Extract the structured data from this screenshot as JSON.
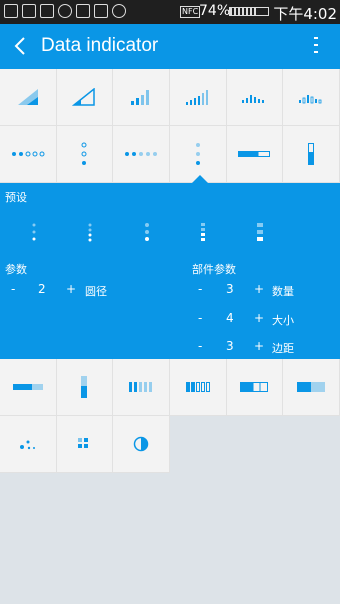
{
  "status": {
    "battery": "74%",
    "nfc": "NFC",
    "time": "下午4:02"
  },
  "appbar": {
    "title": "Data indicator"
  },
  "grid_top": {
    "row1": [
      "signal-triangle-filled-icon",
      "signal-triangle-outline-icon",
      "signal-bars-tall-icon",
      "signal-bars-many-icon",
      "equalizer-bars-icon",
      "dotted-bars-icon"
    ],
    "row2": [
      "dots-horizontal-icon",
      "dots-vertical-icon",
      "dots-horizontal-fade-icon",
      "dots-vertical-fade-icon",
      "horizontal-progress-icon",
      "vertical-progress-icon"
    ]
  },
  "panel": {
    "preset_label": "预设",
    "params_label": "参数",
    "part_params_label": "部件参数",
    "minus": "-",
    "plus": "+",
    "radius": {
      "value": "2",
      "label": "圆径"
    },
    "count": {
      "value": "3",
      "label": "数量"
    },
    "size": {
      "value": "4",
      "label": "大小"
    },
    "margin": {
      "value": "3",
      "label": "边距"
    }
  },
  "grid_bottom": {
    "row1": [
      "horizontal-bar-icon",
      "vertical-bar-icon",
      "segment-bars-filled-icon",
      "segment-bars-outline-icon",
      "block-bar-filled-icon",
      "block-bar-gradient-icon"
    ],
    "row2": [
      "scatter-dots-icon",
      "grid-dots-icon",
      "half-circle-icon"
    ]
  },
  "colors": {
    "accent": "#0a96e6",
    "cell_bg": "#f3f3f3",
    "statusbar": "#1f1f1f",
    "bg": "#dde3e8"
  }
}
